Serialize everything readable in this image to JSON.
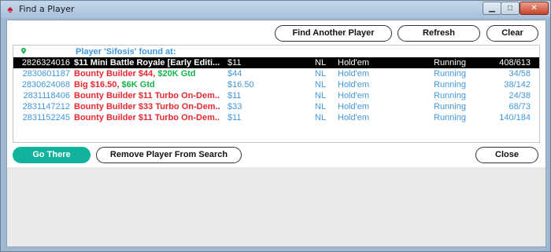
{
  "window": {
    "title": "Find a Player"
  },
  "buttons": {
    "find_another": "Find Another Player",
    "refresh": "Refresh",
    "clear": "Clear",
    "go_there": "Go There",
    "remove_player": "Remove Player From Search",
    "close": "Close"
  },
  "results": {
    "found_label": "Player 'Sifosis' found at:",
    "rows": [
      {
        "id": "2826324016",
        "name_a": "$11 Mini Battle Royale [Early Editi...",
        "name_b": "",
        "buyin": "$11",
        "limit": "NL",
        "game": "Hold'em",
        "status": "Running",
        "players": "408/613"
      },
      {
        "id": "2830601187",
        "name_a": "Bounty Builder $44, ",
        "name_b": "$20K Gtd",
        "buyin": "$44",
        "limit": "NL",
        "game": "Hold'em",
        "status": "Running",
        "players": "34/58"
      },
      {
        "id": "2830624068",
        "name_a": "Big $16.50, ",
        "name_b": "$6K Gtd",
        "buyin": "$16.50",
        "limit": "NL",
        "game": "Hold'em",
        "status": "Running",
        "players": "38/142"
      },
      {
        "id": "2831118406",
        "name_a": "Bounty Builder $11 Turbo On-Dem...",
        "name_b": "",
        "buyin": "$11",
        "limit": "NL",
        "game": "Hold'em",
        "status": "Running",
        "players": "24/38"
      },
      {
        "id": "2831147212",
        "name_a": "Bounty Builder $33 Turbo On-Dem...",
        "name_b": "",
        "buyin": "$33",
        "limit": "NL",
        "game": "Hold'em",
        "status": "Running",
        "players": "68/73"
      },
      {
        "id": "2831152245",
        "name_a": "Bounty Builder $11 Turbo On-Dem...",
        "name_b": "",
        "buyin": "$11",
        "limit": "NL",
        "game": "Hold'em",
        "status": "Running",
        "players": "140/184"
      }
    ]
  },
  "colors": {
    "accent": "#12b39c",
    "link_blue": "#3f97dd",
    "red": "#e8282f",
    "green": "#15b34a",
    "selected_row": "#000000"
  },
  "icons": {
    "app": "pokerstars-spade-icon",
    "pin": "location-pin-icon",
    "minimize": "minimize-icon",
    "maximize": "maximize-icon",
    "close": "close-icon"
  }
}
